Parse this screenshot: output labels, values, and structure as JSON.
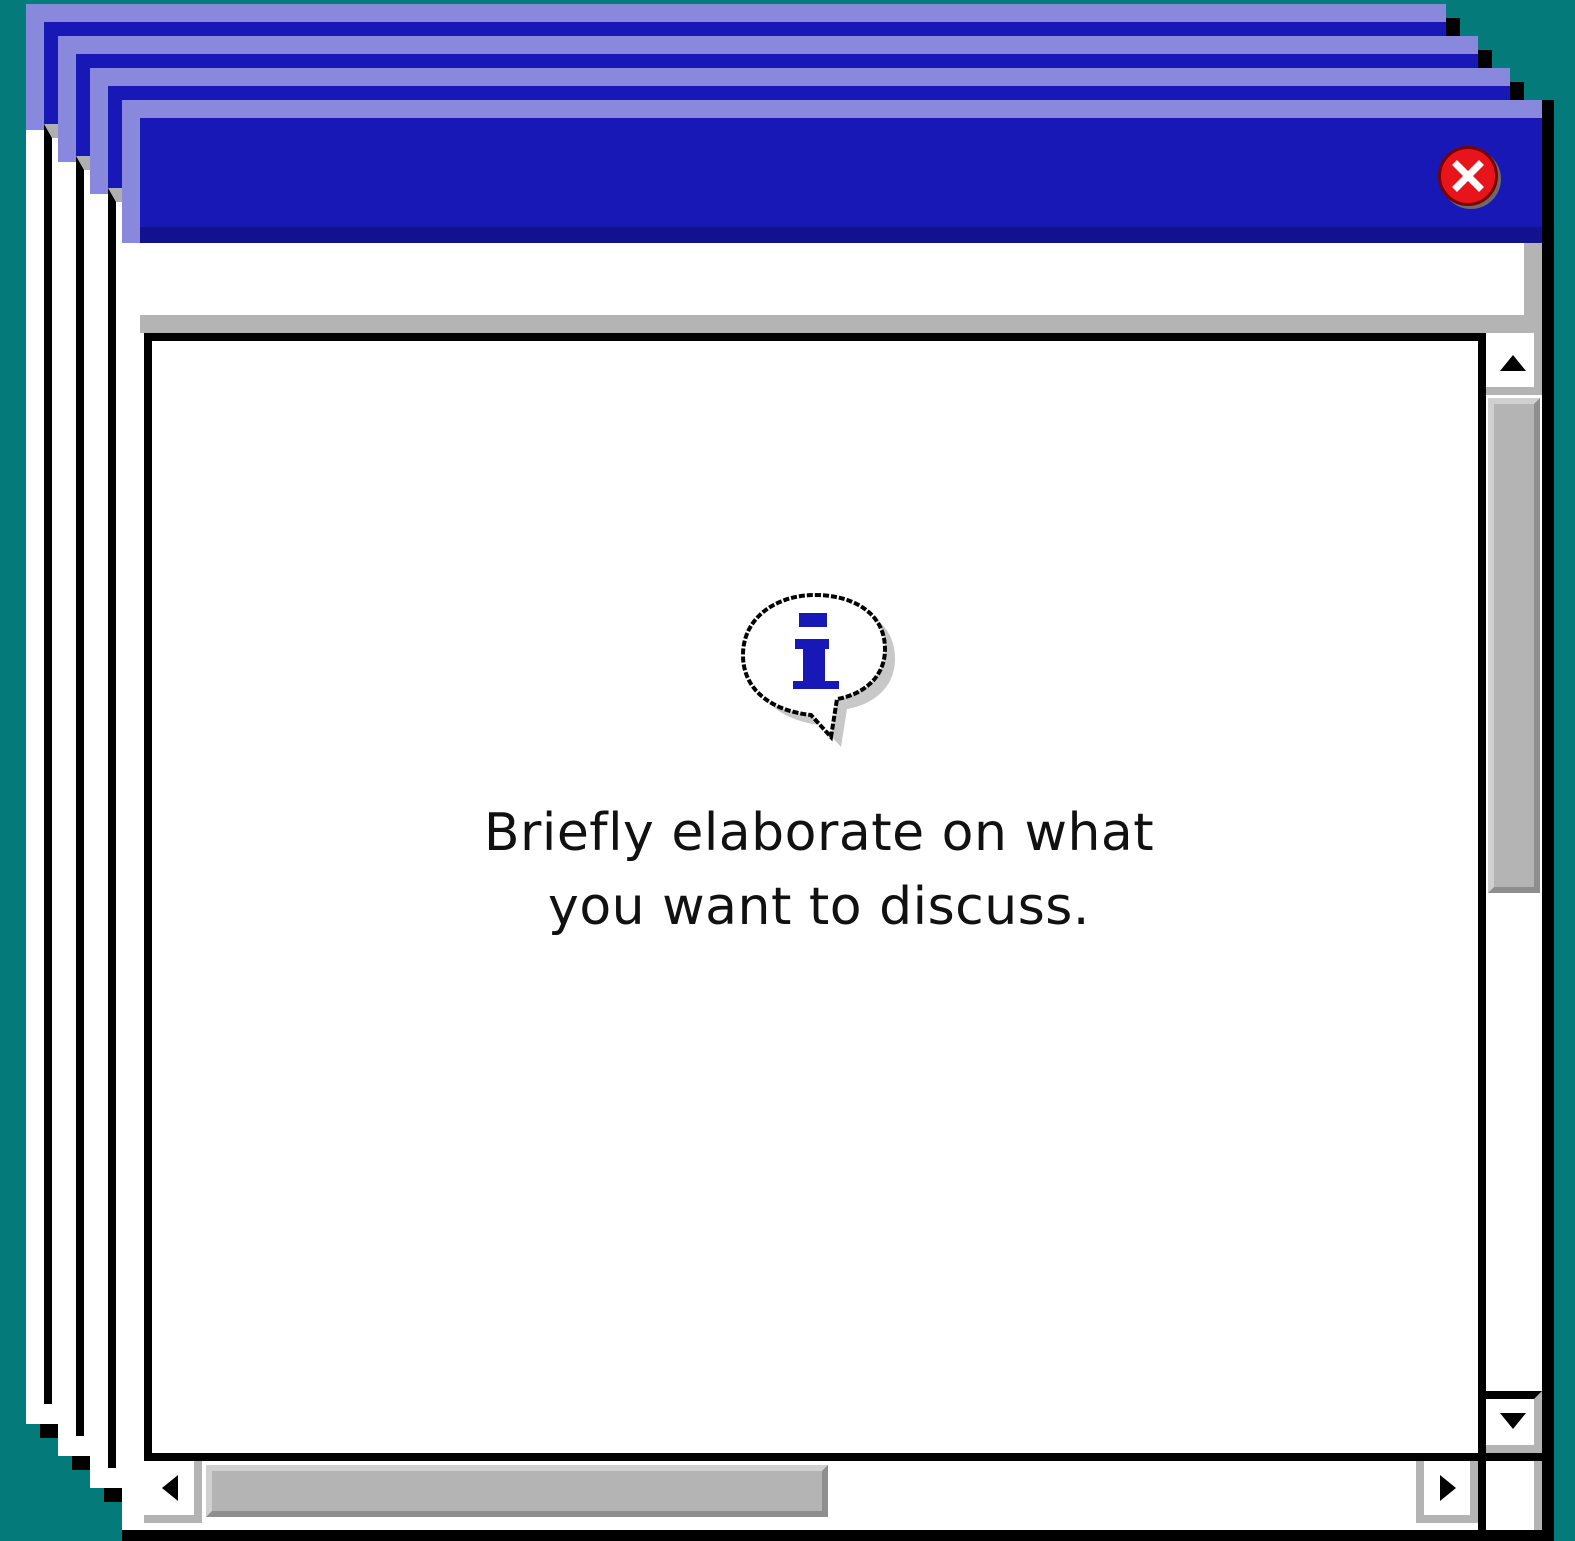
{
  "dialog": {
    "message_line1": "Briefly elaborate on what",
    "message_line2": "you want to discuss."
  },
  "colors": {
    "desktop": "#057a7a",
    "titlebar": "#1818b6",
    "titlebar_highlight": "#8888dc",
    "close_button": "#e8141b",
    "info_glyph": "#1818b6"
  },
  "icons": {
    "close": "close-x-icon",
    "info": "info-speech-bubble-icon",
    "scroll_up": "triangle-up",
    "scroll_down": "triangle-down",
    "scroll_left": "triangle-left",
    "scroll_right": "triangle-right"
  }
}
